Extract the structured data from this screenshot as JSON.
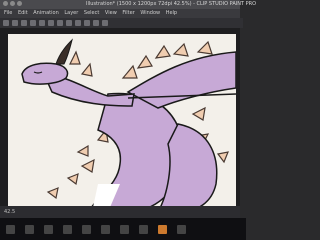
{
  "window": {
    "title": "Illustration* (1500 x 1200px 72dpi 42.5%) - CLIP STUDIO PAINT PRO"
  },
  "menu": [
    "File",
    "Edit",
    "Animation",
    "Layer",
    "Select",
    "View",
    "Filter",
    "Window",
    "Help"
  ],
  "toolbar_icons": [
    "new-file-icon",
    "open-icon",
    "save-icon",
    "undo-icon",
    "redo-icon",
    "clear-icon",
    "fill-icon",
    "transform-icon",
    "selection-icon",
    "deselect-icon",
    "invert-selection-icon",
    "ruler-icon"
  ],
  "status": {
    "zoom": "42.5"
  },
  "taskbar_icons": [
    "windows-icon",
    "search-icon",
    "task-view-icon",
    "file-explorer-icon",
    "browser-icon",
    "store-icon",
    "mail-icon",
    "media-icon",
    "clip-studio-icon",
    "settings-icon"
  ]
}
